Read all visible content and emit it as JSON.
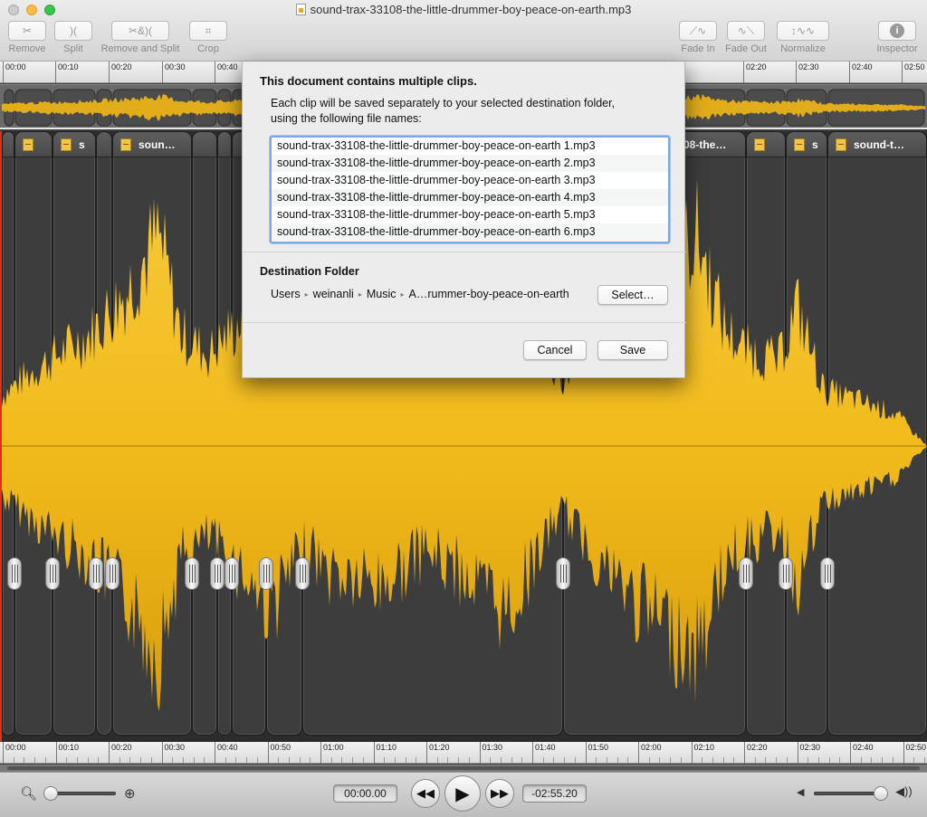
{
  "window": {
    "title": "sound-trax-33108-the-little-drummer-boy-peace-on-earth.mp3"
  },
  "toolbar": {
    "remove": {
      "label": "Remove",
      "icon": "scissors-icon"
    },
    "split": {
      "label": "Split",
      "icon": "split-icon"
    },
    "remove_and_split": {
      "label": "Remove and Split",
      "icon": "scissors-split-icon"
    },
    "crop": {
      "label": "Crop",
      "icon": "crop-icon"
    },
    "fade_in": {
      "label": "Fade In",
      "icon": "fade-in-icon"
    },
    "fade_out": {
      "label": "Fade Out",
      "icon": "fade-out-icon"
    },
    "normalize": {
      "label": "Normalize",
      "icon": "normalize-icon"
    },
    "inspector": {
      "label": "Inspector",
      "icon": "info-icon"
    }
  },
  "ruler": {
    "ticks_left": [
      "00:00",
      "00:10",
      "00:20",
      "00:30",
      "00:40"
    ],
    "ticks_right": [
      "02:20",
      "02:30",
      "02:40",
      "02:50"
    ],
    "ticks_bottom": [
      "00:00",
      "00:10",
      "00:20",
      "00:30",
      "00:40",
      "00:50",
      "01:00",
      "01:10",
      "01:20",
      "01:30",
      "01:40",
      "01:50",
      "02:00",
      "02:10",
      "02:20",
      "02:30",
      "02:40",
      "02:50"
    ]
  },
  "clips": {
    "c3_name": "s",
    "c5_name": "soun…",
    "c14_name": "08-the…",
    "c17_name": "s",
    "c18_name": "sound-t…"
  },
  "sheet": {
    "title": "This document contains multiple clips.",
    "description_line1": "Each clip will be saved separately to your selected destination folder,",
    "description_line2": "using the following file names:",
    "files": [
      "sound-trax-33108-the-little-drummer-boy-peace-on-earth 1.mp3",
      "sound-trax-33108-the-little-drummer-boy-peace-on-earth 2.mp3",
      "sound-trax-33108-the-little-drummer-boy-peace-on-earth 3.mp3",
      "sound-trax-33108-the-little-drummer-boy-peace-on-earth 4.mp3",
      "sound-trax-33108-the-little-drummer-boy-peace-on-earth 5.mp3",
      "sound-trax-33108-the-little-drummer-boy-peace-on-earth 6.mp3"
    ],
    "destination_label": "Destination Folder",
    "path": [
      "Users",
      "weinanli",
      "Music",
      "A…rummer-boy-peace-on-earth"
    ],
    "select_label": "Select…",
    "cancel_label": "Cancel",
    "save_label": "Save"
  },
  "transport": {
    "current_time": "00:00.00",
    "remaining_time": "-02:55.20",
    "zoom_level": 0.0,
    "volume_level": 1.0
  },
  "colors": {
    "waveform": "#f2bb1c",
    "playhead": "#e0301b",
    "focus_ring": "#7ea6e0"
  }
}
